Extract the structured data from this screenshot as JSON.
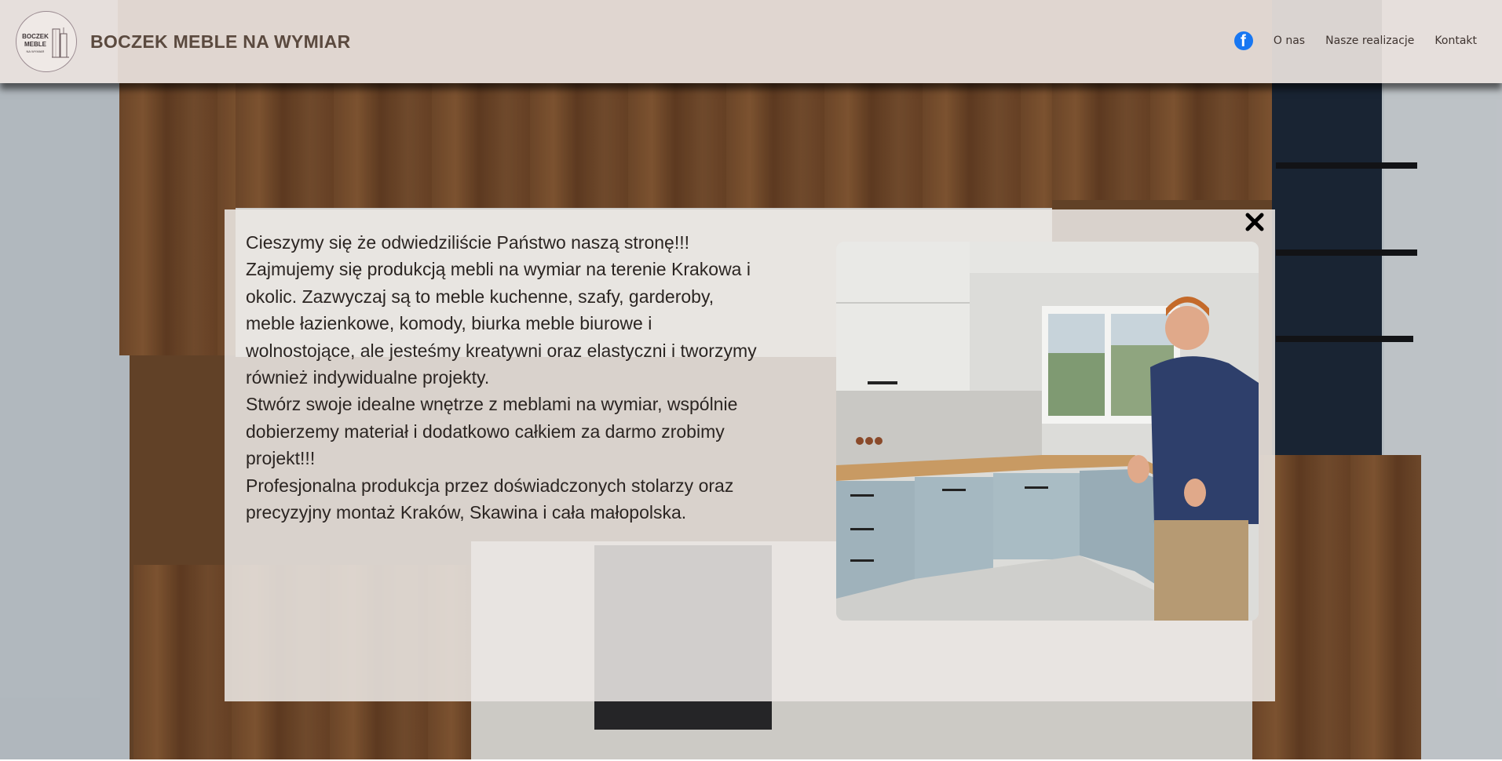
{
  "header": {
    "logo": {
      "line1": "BOCZEK",
      "line2": "MEBLE",
      "line3": "NA WYMIAR"
    },
    "title": "BOCZEK MEBLE NA WYMIAR",
    "nav": {
      "facebook_icon": "facebook-icon",
      "about": "O nas",
      "realizations": "Nasze realizacje",
      "contact": "Kontakt"
    }
  },
  "modal": {
    "close_icon": "close-icon",
    "paragraphs": [
      "Cieszymy się że odwiedziliście Państwo naszą stronę!!!",
      "Zajmujemy się produkcją mebli na wymiar na terenie Krakowa i okolic. Zazwyczaj są to meble kuchenne, szafy, garderoby, meble łazienkowe, komody, biurka meble biurowe i wolnostojące, ale jesteśmy kreatywni oraz elastyczni i tworzymy również indywidualne projekty.",
      "Stwórz swoje idealne wnętrze z meblami na wymiar, wspólnie dobierzemy materiał i dodatkowo całkiem za darmo zrobimy projekt!!!",
      "Profesjonalna produkcja przez doświadczonych stolarzy oraz precyzyjny montaż Kraków, Skawina i cała małopolska."
    ]
  },
  "colors": {
    "header_bg": "#e9e2de",
    "brand_text": "#5b4a3f",
    "facebook_blue": "#1877f2",
    "modal_bg": "#ece8e5",
    "body_text": "#2b2522"
  }
}
